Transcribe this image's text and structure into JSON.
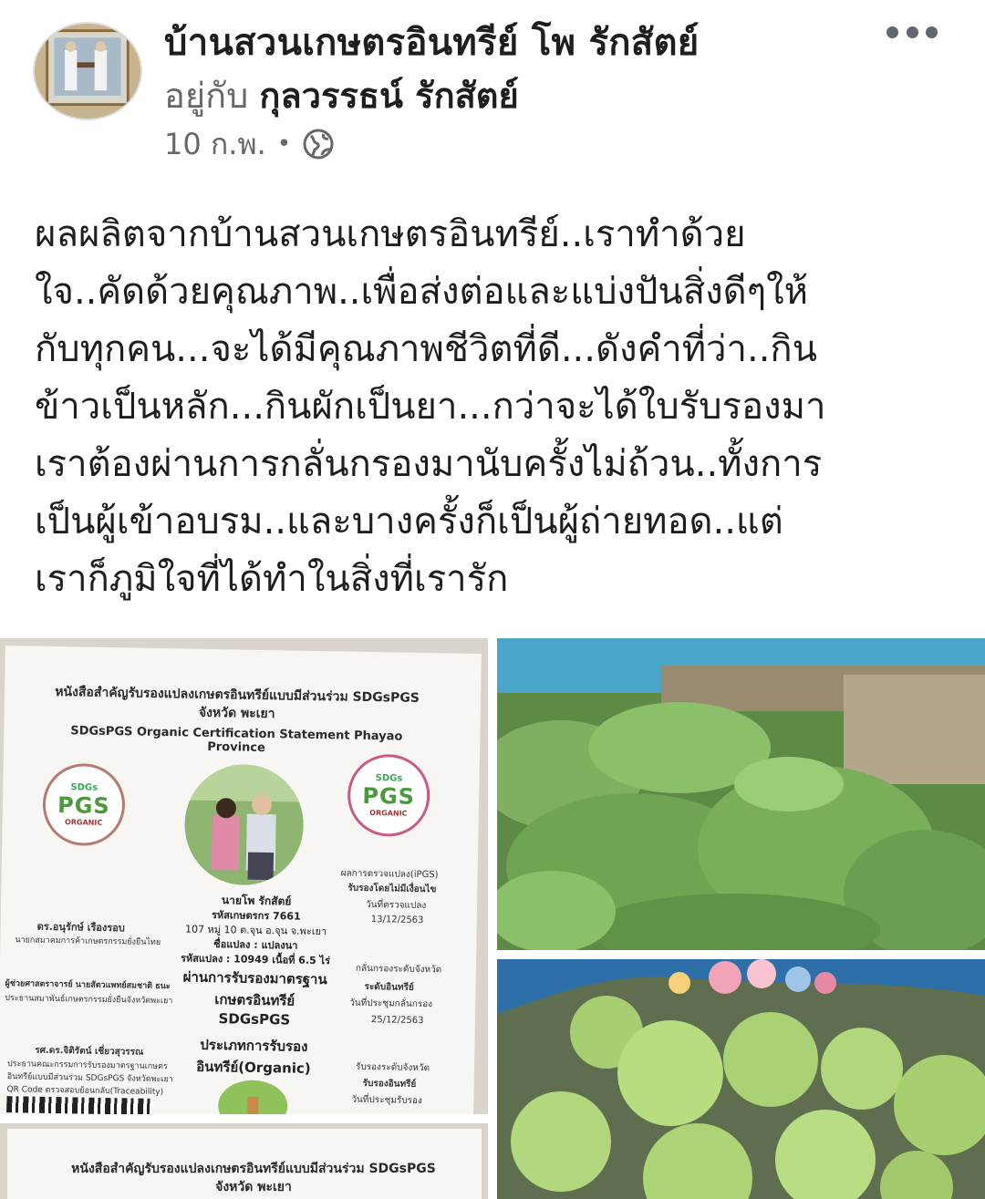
{
  "post": {
    "page_name": "บ้านสวนเกษตรอินทรีย์ โพ รักสัตย์",
    "with_prefix": "อยู่กับ",
    "with_name": "กุลวรรธน์ รักสัตย์",
    "date": "10 ก.พ.",
    "separator": "•",
    "privacy_icon": "globe-icon",
    "more_icon": "more-options-icon",
    "text_lines": [
      "ผลผลิตจากบ้านสวนเกษตรอินทรีย์..เราทำด้วย",
      "ใจ..คัดด้วยคุณภาพ..เพื่อส่งต่อและแบ่งปันสิ่งดีๆให้",
      "กับทุกคน...จะได้มีคุณภาพชีวิตที่ดี...ดังคำที่ว่า..กิน",
      "ข้าวเป็นหลัก...กินผักเป็นยา...กว่าจะได้ใบรับรองมา",
      "เราต้องผ่านการกลั่นกรองมานับครั้งไม่ถ้วน..ทั้งการ",
      "เป็นผู้เข้าอบรม..และบางครั้งก็เป็นผู้ถ่ายทอด..แต่",
      "เราก็ภูมิใจที่ได้ทำในสิ่งที่เรารัก"
    ]
  },
  "certificate": {
    "title_th_1": "หนังสือสำคัญรับรองแปลงเกษตรอินทรีย์แบบมีส่วนร่วม SDGsPGS",
    "title_th_2": "จังหวัด พะเยา",
    "title_en": "SDGsPGS Organic Certification Statement Phayao Province",
    "seal_top": "SDGs",
    "seal_main": "PGS",
    "seal_sub": "ORGANIC",
    "farmer_name": "นายโพ รักสัตย์",
    "farmer_code": "รหัสเกษตรกร 7661",
    "address": "107 หมู่ 10 ต.จุน อ.จุน จ.พะเยา",
    "plot_name": "ชื่อแปลง : แปลงนา",
    "plot_code": "รหัสแปลง : 10949 เนื้อที่ 6.5 ไร่",
    "passed": "ผ่านการรับรองมาตรฐาน",
    "standard_1": "เกษตรอินทรีย์",
    "standard_2": "SDGsPGS",
    "cert_type_1": "ประเภทการรับรอง",
    "cert_type_2": "อินทรีย์(Organic)",
    "inspect_title": "ผลการตรวจแปลง(iPGS)",
    "inspect_result": "รับรองโดยไม่มีเงื่อนไข",
    "inspect_date_label": "วันที่ตรวจแปลง",
    "inspect_date": "13/12/2563",
    "screen_level": "กลั่นกรองระดับจังหวัด",
    "screen_result": "ระดับอินทรีย์",
    "screen_date_label": "วันที่ประชุมกลั่นกรอง",
    "screen_date": "25/12/2563",
    "approve_level": "รับรองระดับจังหวัด",
    "approve_result": "รับรองอินทรีย์",
    "approve_date_label": "วันที่ประชุมรับรอง",
    "signer1_name": "ดร.อนุรักษ์ เรืองรอบ",
    "signer1_role": "นายกสมาคมการค้าเกษตรกรรมยั่งยืนไทย",
    "signer2_name": "ผู้ช่วยศาสตราจารย์ นายสัตวแพทย์สมชาติ ธนะ",
    "signer2_role": "ประธานสมาพันธ์เกษตรกรรมยั่งยืนจังหวัดพะเยา",
    "signer3_name": "รศ.ดร.จิติรัตน์ เชี่ยวสุวรรณ",
    "signer3_role_1": "ประธานคณะกรรมการรับรองมาตรฐานเกษตร",
    "signer3_role_2": "อินทรีย์แบบมีส่วนร่วม SDGsPGS จังหวัดพะเยา",
    "qr_text": "QR Code ตรวจสอบย้อนกลับ(Traceability)"
  },
  "colors": {
    "name_text": "#1c1e21",
    "meta_text": "#65676b",
    "pgs_green": "#4a9a3a"
  }
}
